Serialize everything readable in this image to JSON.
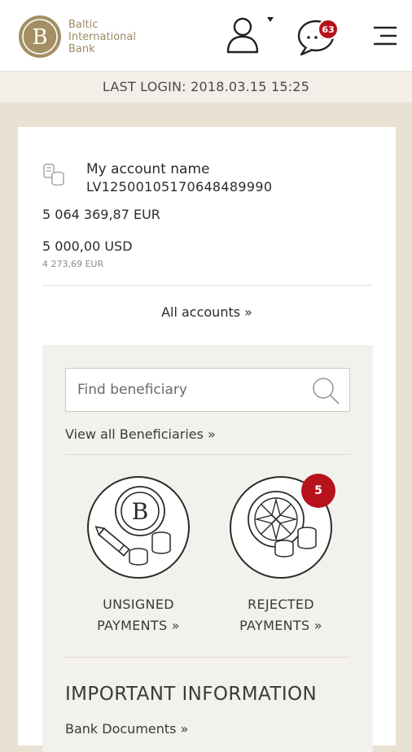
{
  "header": {
    "logo_letter": "B",
    "logo_line1": "Baltic",
    "logo_line2": "International",
    "logo_line3": "Bank",
    "messages_count": "63",
    "user_icon": "user-dropdown-icon",
    "messages_icon": "chat-bubble-icon",
    "menu_icon": "hamburger-menu-icon"
  },
  "last_login": "LAST LOGIN: 2018.03.15 15:25",
  "account": {
    "name": "My account name",
    "iban": "LV12500105170648489990",
    "balance_primary": "5 064 369,87 EUR",
    "balance_secondary": "5 000,00 USD",
    "balance_secondary_eq": "4 273,69 EUR",
    "all_accounts_label": "All accounts »"
  },
  "beneficiary": {
    "search_placeholder": "Find beneficiary",
    "search_value": "",
    "view_all_label": "View all Beneficiaries »"
  },
  "payments": {
    "unsigned_line1": "UNSIGNED",
    "unsigned_line2": "PAYMENTS »",
    "rejected_line1": "REJECTED",
    "rejected_line2": "PAYMENTS »",
    "rejected_count": "5"
  },
  "important": {
    "title": "IMPORTANT INFORMATION",
    "bank_documents_label": "Bank Documents »"
  },
  "colors": {
    "brand_gold": "#9c8b63",
    "badge_red": "#b5121b",
    "page_bg": "#e8e1d4"
  }
}
